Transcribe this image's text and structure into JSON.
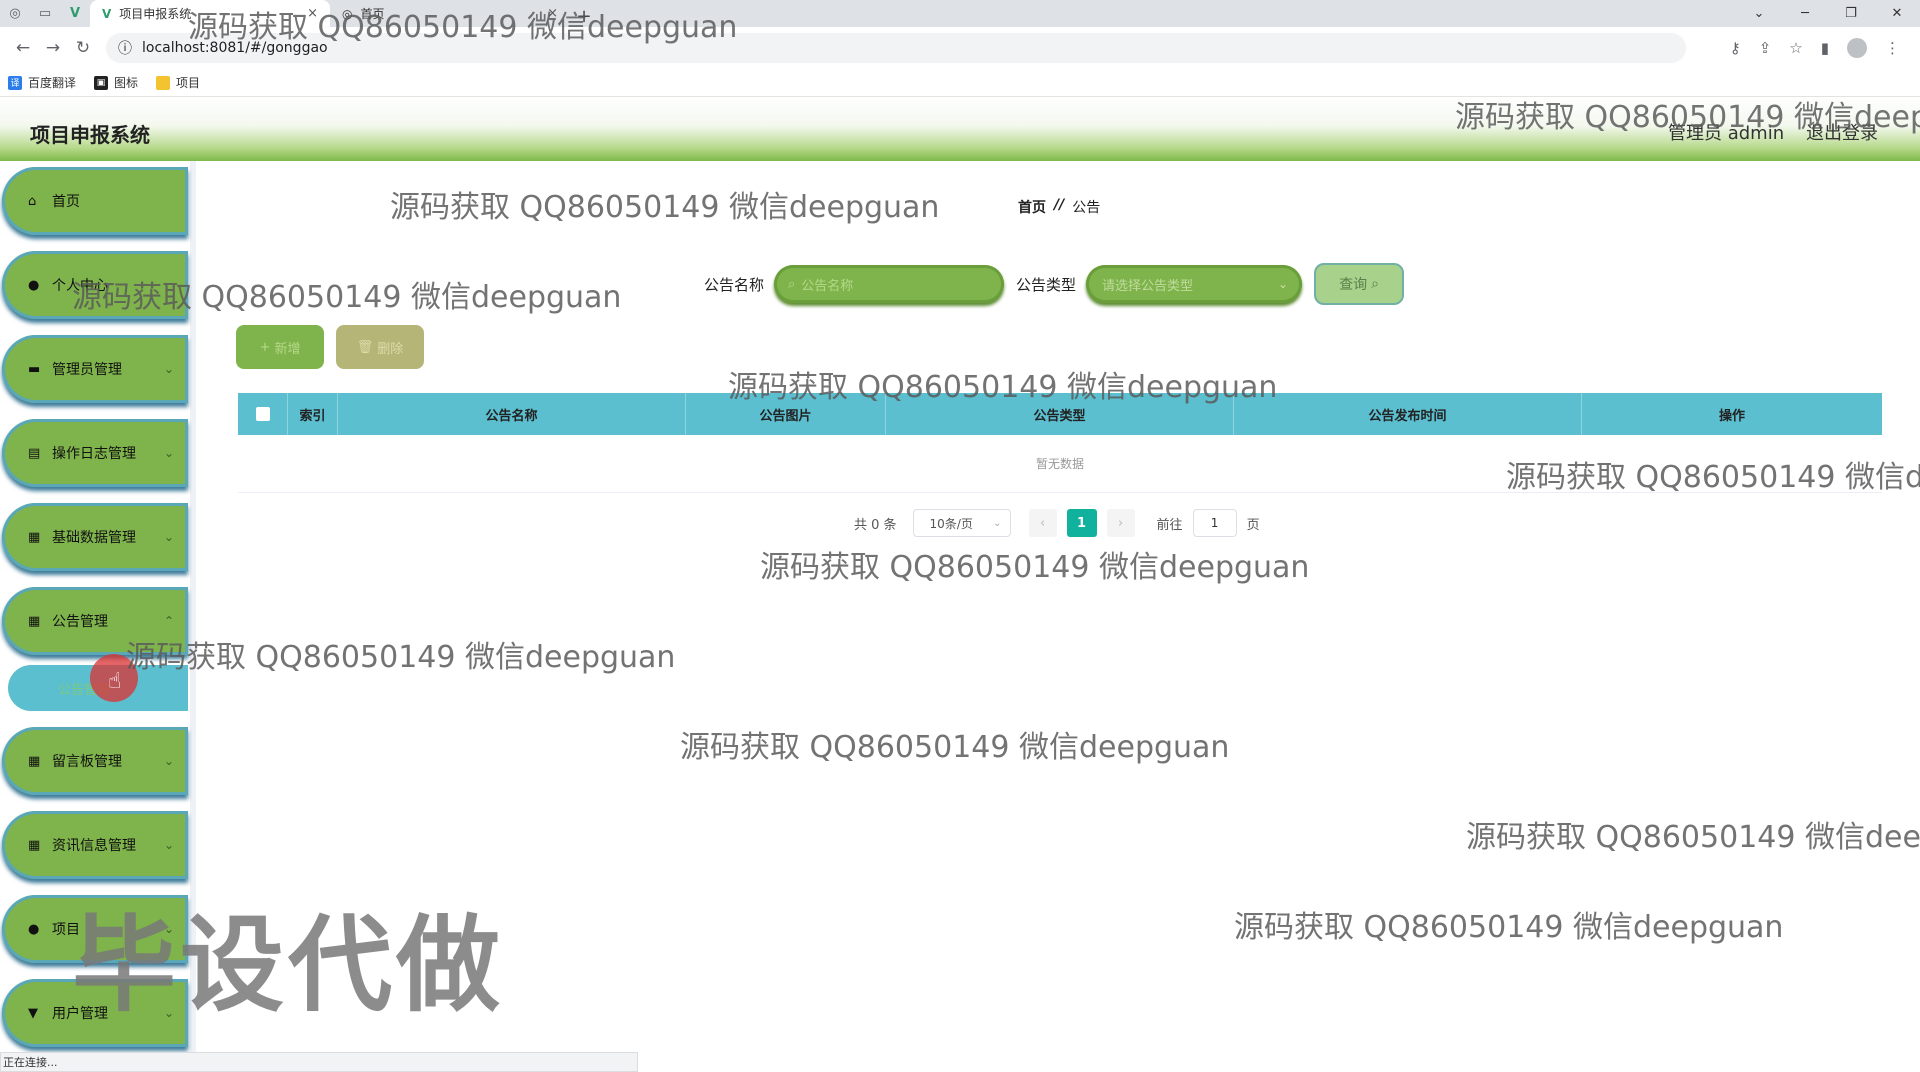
{
  "browser": {
    "tabs": [
      {
        "title": "项目申报系统",
        "close": "×"
      },
      {
        "title": "首页",
        "close": "×"
      }
    ],
    "new_tab": "+",
    "url": "localhost:8081/#/gonggao",
    "bookmarks": [
      "百度翻译",
      "图标",
      "项目"
    ],
    "status": "正在连接..."
  },
  "header": {
    "title": "项目申报系统",
    "user": "管理员 admin",
    "logout": "退出登录"
  },
  "sidebar": {
    "items": [
      {
        "label": "首页",
        "icon": "home-icon"
      },
      {
        "label": "个人中心",
        "icon": "user-icon"
      },
      {
        "label": "管理员管理",
        "icon": "monitor-icon"
      },
      {
        "label": "操作日志管理",
        "icon": "clipboard-icon"
      },
      {
        "label": "基础数据管理",
        "icon": "grid-icon"
      },
      {
        "label": "公告管理",
        "icon": "grid-icon"
      },
      {
        "label": "留言板管理",
        "icon": "grid-icon"
      },
      {
        "label": "资讯信息管理",
        "icon": "grid-icon"
      },
      {
        "label": "项目",
        "icon": "user-icon"
      },
      {
        "label": "用户管理",
        "icon": "cup-icon"
      }
    ],
    "submenu": {
      "label": "公告管理"
    }
  },
  "breadcrumb": {
    "home": "首页",
    "sep": "//",
    "current": "公告"
  },
  "search": {
    "name_label": "公告名称",
    "name_placeholder": "公告名称",
    "type_label": "公告类型",
    "type_placeholder": "请选择公告类型",
    "query_button": "查询"
  },
  "actions": {
    "add": "新增",
    "delete": "删除"
  },
  "table": {
    "columns": [
      "索引",
      "公告名称",
      "公告图片",
      "公告类型",
      "公告发布时间",
      "操作"
    ],
    "empty_text": "暂无数据"
  },
  "pagination": {
    "total": "共 0 条",
    "page_size": "10条/页",
    "current_page": "1",
    "goto_label": "前往",
    "goto_value": "1",
    "page_suffix": "页"
  },
  "watermarks": {
    "text": "源码获取 QQ86050149 微信deepguan",
    "text_cut1": "源码获取 QQ86050149 微信deep",
    "text_cut2": "源码获取 QQ86050149 微信de",
    "big": "毕设代做"
  },
  "colors": {
    "menu_green": "#7fb34b",
    "teal": "#5bbfcf",
    "page_active": "#10b29e"
  }
}
